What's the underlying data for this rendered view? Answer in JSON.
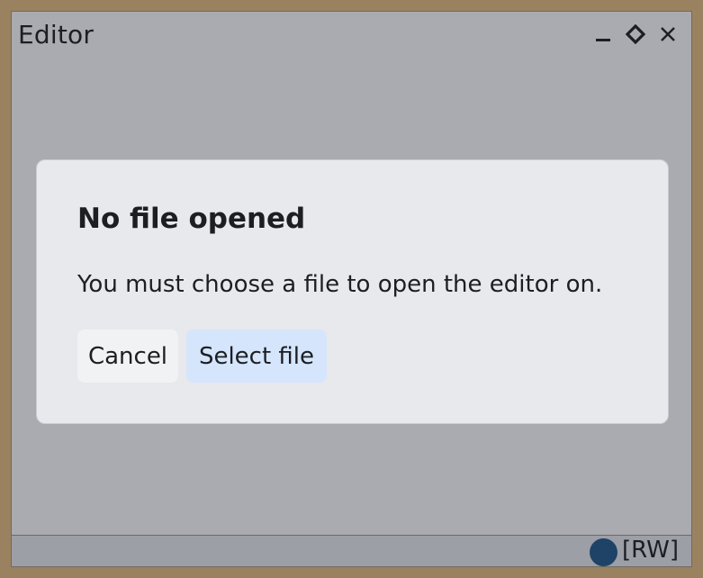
{
  "window": {
    "title": "Editor",
    "controls": {
      "minimize_icon": "minimize-icon",
      "maximize_icon": "diamond-icon",
      "close_icon": "close-icon"
    }
  },
  "dialog": {
    "title": "No file opened",
    "message": "You must choose a file to open the editor on.",
    "cancel_label": "Cancel",
    "select_label": "Select file"
  },
  "statusbar": {
    "mode": "[RW]",
    "indicator_color": "#1f4366"
  },
  "colors": {
    "desktop": "#9a8260",
    "window_bg": "#a9abb0",
    "dialog_bg": "#e8e9ed",
    "primary_button": "#d5e5fb"
  }
}
